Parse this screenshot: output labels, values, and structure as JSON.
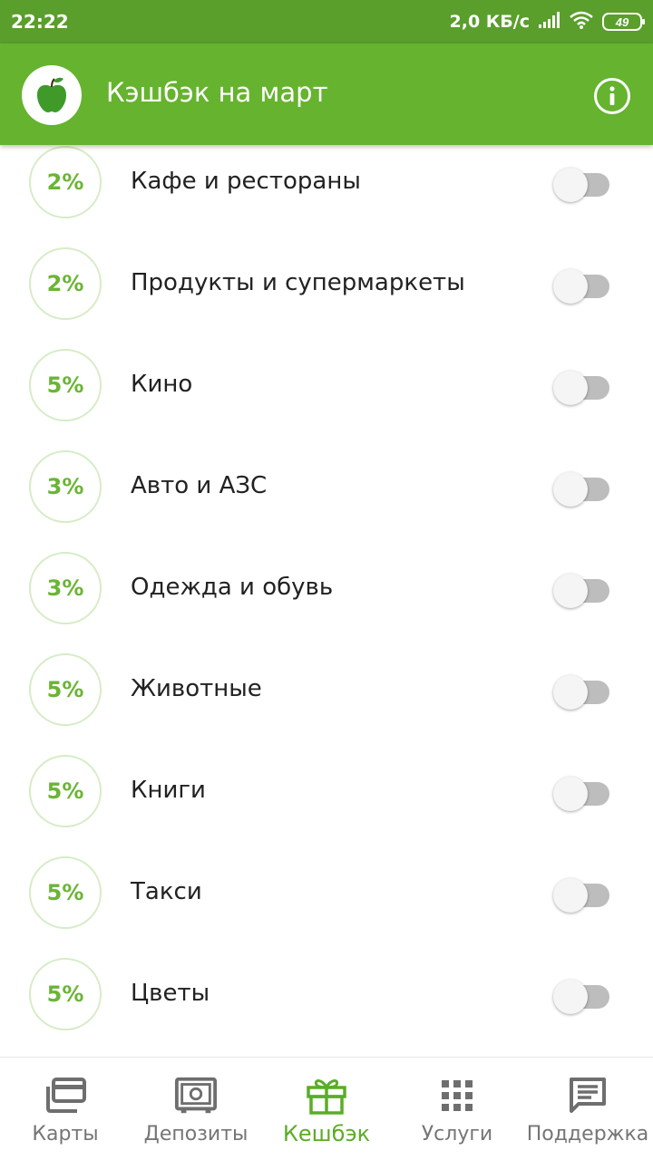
{
  "status_bar": {
    "time": "22:22",
    "network_speed": "2,0 КБ/с",
    "battery": "49",
    "icons": [
      "signal-icon",
      "wifi-icon",
      "battery-icon"
    ]
  },
  "app_bar": {
    "title": "Кэшбэк на март",
    "logo_icon": "apple-icon",
    "info_icon": "info-icon",
    "colors": {
      "primary": "#65b32e",
      "status": "#5a9e2c",
      "accent": "#6ab534"
    }
  },
  "categories": [
    {
      "percent": "2%",
      "name": "Кафе и рестораны",
      "enabled": false
    },
    {
      "percent": "2%",
      "name": "Продукты и супермаркеты",
      "enabled": false
    },
    {
      "percent": "5%",
      "name": "Кино",
      "enabled": false
    },
    {
      "percent": "3%",
      "name": "Авто и АЗС",
      "enabled": false
    },
    {
      "percent": "3%",
      "name": "Одежда и обувь",
      "enabled": false
    },
    {
      "percent": "5%",
      "name": "Животные",
      "enabled": false
    },
    {
      "percent": "5%",
      "name": "Книги",
      "enabled": false
    },
    {
      "percent": "5%",
      "name": "Такси",
      "enabled": false
    },
    {
      "percent": "5%",
      "name": "Цветы",
      "enabled": false
    }
  ],
  "bottom_nav": {
    "active": "cashback",
    "items": [
      {
        "label": "Карты",
        "icon": "cards-icon"
      },
      {
        "label": "Депозиты",
        "icon": "safe-icon"
      },
      {
        "label": "Кешбэк",
        "icon": "gift-icon"
      },
      {
        "label": "Услуги",
        "icon": "grid-icon"
      },
      {
        "label": "Поддержка",
        "icon": "chat-icon"
      }
    ]
  }
}
